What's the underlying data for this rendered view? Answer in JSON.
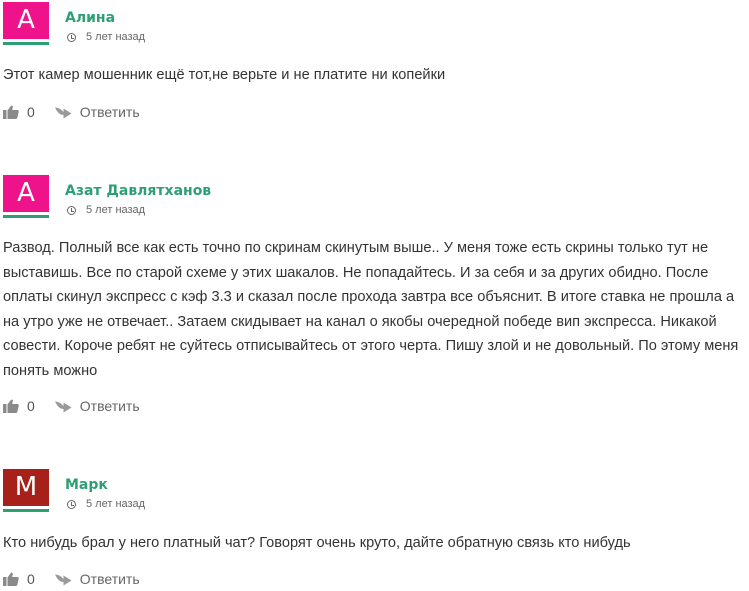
{
  "comments": [
    {
      "avatar_letter": "А",
      "avatar_color": "#ee138a",
      "author": "Алина",
      "time": "5 лет назад",
      "text": "Этот камер мошенник ещё тот,не верьте и не платите ни копейки",
      "likes": "0",
      "reply_label": "Ответить",
      "like_icon": "thumbs-up-icon",
      "reply_icon": "reply-arrow-icon",
      "time_icon": "clock-icon"
    },
    {
      "avatar_letter": "А",
      "avatar_color": "#ee138a",
      "author": "Азат Давлятханов",
      "time": "5 лет назад",
      "text": "Развод. Полный все как есть точно по скринам скинутым выше.. У меня тоже есть скрины только тут не выставишь. Все по старой схеме у этих шакалов. Не попадайтесь. И за себя и за других обидно. После оплаты скинул экспресс с кэф 3.3 и сказал после прохода завтра все объяснит. В итоге ставка не прошла а на утро уже не отвечает.. Затаем скидывает на канал о якобы очередной победе вип экспресса. Никакой совести. Короче ребят не суйтесь отписывайтесь от этого черта. Пишу злой и не довольный. По этому меня понять можно",
      "likes": "0",
      "reply_label": "Ответить",
      "like_icon": "thumbs-up-icon",
      "reply_icon": "reply-arrow-icon",
      "time_icon": "clock-icon"
    },
    {
      "avatar_letter": "М",
      "avatar_color": "#a8201a",
      "author": "Марк",
      "time": "5 лет назад",
      "text": "Кто нибудь брал у него платный чат? Говорят очень круто, дайте обратную связь кто нибудь",
      "likes": "0",
      "reply_label": "Ответить",
      "like_icon": "thumbs-up-icon",
      "reply_icon": "reply-arrow-icon",
      "time_icon": "clock-icon"
    }
  ],
  "colors": {
    "author_link": "#2e9e74",
    "avatar_underline": "#2e9e74",
    "text": "#333333",
    "meta": "#666666"
  }
}
